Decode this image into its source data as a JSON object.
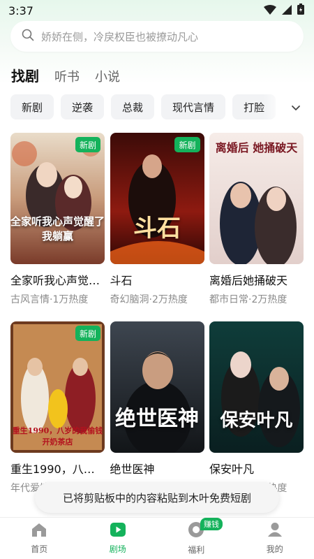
{
  "status_bar": {
    "time": "3:37"
  },
  "search": {
    "placeholder": "娇娇在侧，冷戾权臣也被撩动凡心"
  },
  "main_tabs": [
    {
      "label": "找剧",
      "active": true
    },
    {
      "label": "听书",
      "active": false
    },
    {
      "label": "小说",
      "active": false
    }
  ],
  "chips": [
    "新剧",
    "逆袭",
    "总裁",
    "现代言情",
    "打脸"
  ],
  "cards": [
    {
      "title": "全家听我心声觉醒了，我躺赢",
      "meta": "古风言情·1万热度",
      "badge": "新剧",
      "poster_text": "全家听我心声觉醒了 我躺赢"
    },
    {
      "title": "斗石",
      "meta": "奇幻脑洞·2万热度",
      "badge": "新剧",
      "poster_text": "斗石"
    },
    {
      "title": "离婚后她捅破天",
      "meta": "都市日常·2万热度",
      "badge": "",
      "poster_text": "离婚后 她捅破天"
    },
    {
      "title": "重生1990，八岁的我偷钱开奶茶店",
      "meta": "年代爱情·1万热度",
      "badge": "新剧",
      "poster_text": "重生1990，八岁的我偷钱开奶茶店"
    },
    {
      "title": "绝世医神",
      "meta": "",
      "badge": "",
      "poster_text": "绝世医神"
    },
    {
      "title": "保安叶凡",
      "meta": "都市逆袭·2万热度",
      "badge": "",
      "poster_text": "保安叶凡"
    }
  ],
  "toast": {
    "text": "已将剪贴板中的内容粘贴到木叶免费短剧"
  },
  "bottom_nav": [
    {
      "label": "首页",
      "icon": "home-icon",
      "active": false
    },
    {
      "label": "剧场",
      "icon": "play-icon",
      "active": true
    },
    {
      "label": "福利",
      "icon": "welfare-icon",
      "active": false,
      "badge": "赚钱"
    },
    {
      "label": "我的",
      "icon": "user-icon",
      "active": false
    }
  ],
  "colors": {
    "accent": "#14b25b",
    "chip_bg": "#f2f3f5",
    "meta_text": "#8a8a8a"
  }
}
